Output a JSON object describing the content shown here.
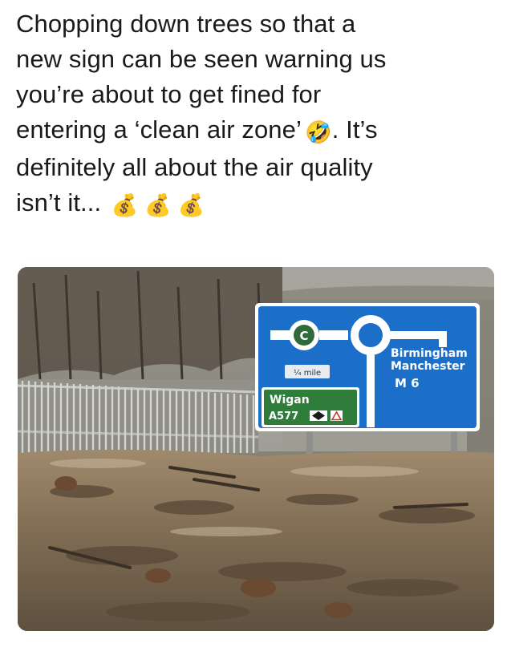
{
  "caption": {
    "line1": "Chopping down trees so that a",
    "line2": "new sign can be seen warning us",
    "line3": "you’re about to get fined for",
    "line4a": "entering a ‘clean air zone’",
    "line4_emoji": "🤣",
    "line4b": ". It’s",
    "line5": "definitely all about the air quality",
    "line6a": "isn’t it...",
    "line6_emoji": "💰 💰 💰"
  },
  "photo": {
    "sign": {
      "distance": "¼ mile",
      "dest1": "Birmingham",
      "dest2": "Manchester",
      "motorway": "M 6",
      "left_dest": "Wigan",
      "road": "A577",
      "caz_symbol": "C",
      "colors": {
        "sign_blue": "#1b6fc9",
        "green_panel": "#2f7d3a",
        "white": "#ffffff"
      }
    }
  }
}
